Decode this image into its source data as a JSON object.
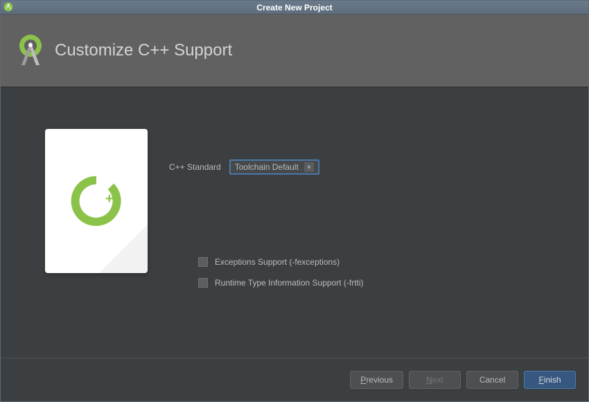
{
  "titlebar": {
    "title": "Create New Project"
  },
  "header": {
    "title": "Customize C++ Support"
  },
  "form": {
    "standard_label": "C++ Standard",
    "standard_value": "Toolchain Default"
  },
  "checkboxes": {
    "exceptions_label": "Exceptions Support (-fexceptions)",
    "rtti_label": "Runtime Type Information Support (-frtti)"
  },
  "buttons": {
    "previous_mnemonic": "P",
    "previous_rest": "revious",
    "next_mnemonic": "N",
    "next_rest": "ext",
    "cancel": "Cancel",
    "finish_mnemonic": "F",
    "finish_rest": "inish"
  }
}
